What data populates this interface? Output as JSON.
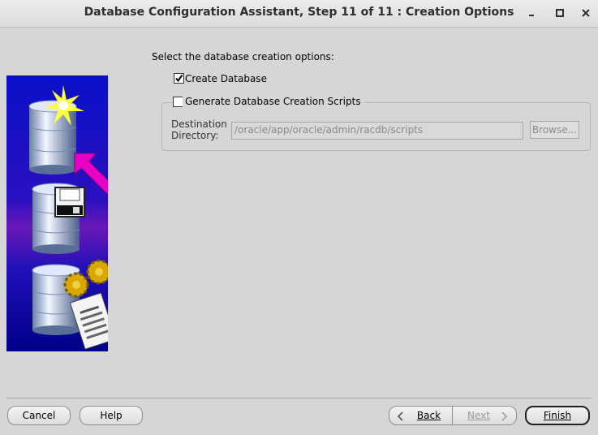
{
  "window": {
    "title": "Database Configuration Assistant, Step 11 of 11 : Creation Options"
  },
  "main": {
    "prompt": "Select the database creation options:",
    "create_database": {
      "label": "Create Database",
      "checked": true
    },
    "generate_scripts": {
      "label": "Generate Database Creation Scripts",
      "checked": false
    },
    "destination": {
      "label_line1": "Destination",
      "label_line2": "Directory:",
      "value": "/oracle/app/oracle/admin/racdb/scripts",
      "browse_label": "Browse..."
    }
  },
  "footer": {
    "cancel": "Cancel",
    "help": "Help",
    "back": "Back",
    "next": "Next",
    "finish": "Finish"
  },
  "colors": {
    "background": "#d6d6d6",
    "banner_blue": "#0a10c8",
    "arrow_magenta": "#e600c8",
    "disabled_text": "#8a8a8a"
  }
}
